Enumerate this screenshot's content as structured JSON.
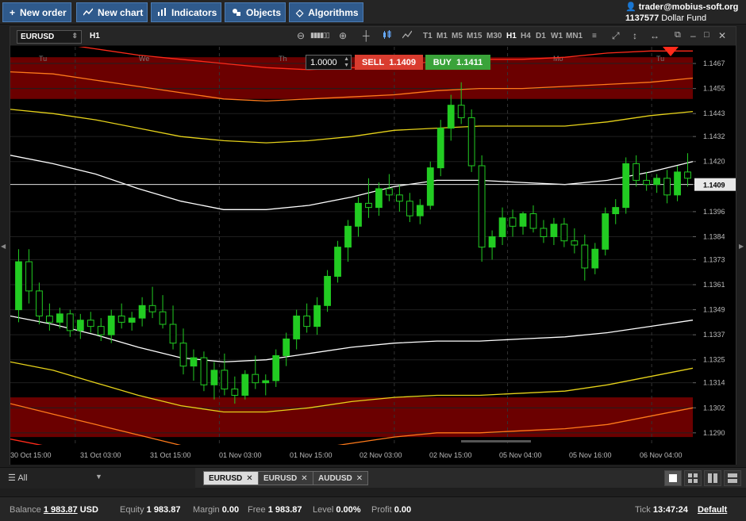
{
  "toolbar": {
    "new_order": "New order",
    "new_chart": "New chart",
    "indicators": "Indicators",
    "objects": "Objects",
    "algorithms": "Algorithms"
  },
  "account": {
    "user": "trader@mobius-soft.org",
    "id": "1137577",
    "fund": "Dollar Fund"
  },
  "chart": {
    "symbol": "EURUSD",
    "timeframe": "H1",
    "timeframes": [
      "T1",
      "M1",
      "M5",
      "M15",
      "M30",
      "H1",
      "H4",
      "D1",
      "W1",
      "MN1"
    ],
    "active_timeframe": "H1",
    "quantity": "1.0000",
    "sell_label": "SELL",
    "sell_price": "1.1409",
    "buy_label": "BUY",
    "buy_price": "1.1411",
    "day_labels": [
      "Tu",
      "We",
      "Th",
      "Mo",
      "Tu"
    ],
    "price_ticks": [
      "1.1467",
      "1.1455",
      "1.1443",
      "1.1432",
      "1.1420",
      "1.1409",
      "1.1396",
      "1.1384",
      "1.1373",
      "1.1361",
      "1.1349",
      "1.1337",
      "1.1325",
      "1.1314",
      "1.1302",
      "1.1290"
    ],
    "current_price": "1.1409",
    "time_ticks": [
      "30 Oct 15:00",
      "31 Oct 03:00",
      "31 Oct 15:00",
      "01 Nov 03:00",
      "01 Nov 15:00",
      "02 Nov 03:00",
      "02 Nov 15:00",
      "05 Nov 04:00",
      "05 Nov 16:00",
      "06 Nov 04:00"
    ],
    "colors": {
      "bull": "#22cc22",
      "band_fill": "#6b0000",
      "outer": "#ff2a1a",
      "mid_outer": "#ff7a1a",
      "inner": "#e6d21a",
      "center": "#ffffff"
    }
  },
  "chart_data": {
    "type": "candlestick",
    "symbol": "EURUSD",
    "timeframe": "H1",
    "ylim": [
      1.1285,
      1.1475
    ],
    "candles": [
      [
        1.1349,
        1.1378,
        1.1343,
        1.1372
      ],
      [
        1.1372,
        1.1378,
        1.1352,
        1.1358
      ],
      [
        1.1358,
        1.1362,
        1.1342,
        1.1346
      ],
      [
        1.1346,
        1.1352,
        1.1339,
        1.1343
      ],
      [
        1.1343,
        1.135,
        1.134,
        1.1347
      ],
      [
        1.1347,
        1.1349,
        1.1336,
        1.1339
      ],
      [
        1.1339,
        1.1347,
        1.1335,
        1.1344
      ],
      [
        1.1344,
        1.1348,
        1.1338,
        1.1341
      ],
      [
        1.1341,
        1.1345,
        1.1334,
        1.1337
      ],
      [
        1.1337,
        1.1349,
        1.1333,
        1.1346
      ],
      [
        1.1346,
        1.1352,
        1.134,
        1.1343
      ],
      [
        1.1343,
        1.1348,
        1.1339,
        1.1345
      ],
      [
        1.1345,
        1.1355,
        1.1341,
        1.1351
      ],
      [
        1.1351,
        1.136,
        1.1345,
        1.1348
      ],
      [
        1.1348,
        1.1356,
        1.134,
        1.1342
      ],
      [
        1.1342,
        1.1351,
        1.133,
        1.1333
      ],
      [
        1.1333,
        1.134,
        1.1318,
        1.1322
      ],
      [
        1.1322,
        1.133,
        1.1315,
        1.1326
      ],
      [
        1.1326,
        1.1329,
        1.131,
        1.1313
      ],
      [
        1.1313,
        1.1324,
        1.1306,
        1.132
      ],
      [
        1.132,
        1.1328,
        1.1308,
        1.1311
      ],
      [
        1.1311,
        1.1317,
        1.1304,
        1.1308
      ],
      [
        1.1308,
        1.132,
        1.1306,
        1.1318
      ],
      [
        1.1318,
        1.1327,
        1.1311,
        1.1314
      ],
      [
        1.1314,
        1.1318,
        1.1308,
        1.1315
      ],
      [
        1.1315,
        1.133,
        1.1312,
        1.1327
      ],
      [
        1.1327,
        1.1338,
        1.1322,
        1.1335
      ],
      [
        1.1335,
        1.1349,
        1.133,
        1.1346
      ],
      [
        1.1346,
        1.1352,
        1.1338,
        1.1341
      ],
      [
        1.1341,
        1.1355,
        1.1337,
        1.1351
      ],
      [
        1.1351,
        1.1368,
        1.1348,
        1.1365
      ],
      [
        1.1365,
        1.1382,
        1.1362,
        1.1379
      ],
      [
        1.1379,
        1.1392,
        1.1372,
        1.1389
      ],
      [
        1.1389,
        1.1403,
        1.1384,
        1.14
      ],
      [
        1.14,
        1.1412,
        1.1393,
        1.1398
      ],
      [
        1.1398,
        1.141,
        1.1394,
        1.1407
      ],
      [
        1.1407,
        1.1414,
        1.1401,
        1.1404
      ],
      [
        1.1404,
        1.1409,
        1.1396,
        1.1401
      ],
      [
        1.1401,
        1.1405,
        1.1391,
        1.1394
      ],
      [
        1.1394,
        1.1402,
        1.139,
        1.1399
      ],
      [
        1.1399,
        1.142,
        1.1397,
        1.1417
      ],
      [
        1.1417,
        1.144,
        1.1413,
        1.1436
      ],
      [
        1.1436,
        1.1452,
        1.143,
        1.1447
      ],
      [
        1.1447,
        1.1458,
        1.1438,
        1.1441
      ],
      [
        1.1441,
        1.1445,
        1.1415,
        1.1418
      ],
      [
        1.1418,
        1.1423,
        1.1372,
        1.1379
      ],
      [
        1.1379,
        1.1387,
        1.1373,
        1.1384
      ],
      [
        1.1384,
        1.1398,
        1.138,
        1.1393
      ],
      [
        1.1393,
        1.1397,
        1.1384,
        1.1389
      ],
      [
        1.1389,
        1.1396,
        1.1385,
        1.1395
      ],
      [
        1.1395,
        1.1399,
        1.1386,
        1.1388
      ],
      [
        1.1388,
        1.1392,
        1.1381,
        1.1384
      ],
      [
        1.1384,
        1.1393,
        1.138,
        1.139
      ],
      [
        1.139,
        1.1393,
        1.1379,
        1.1382
      ],
      [
        1.1382,
        1.1388,
        1.1376,
        1.138
      ],
      [
        1.138,
        1.1385,
        1.1363,
        1.1369
      ],
      [
        1.1369,
        1.1381,
        1.1366,
        1.1378
      ],
      [
        1.1378,
        1.1398,
        1.1375,
        1.1395
      ],
      [
        1.1395,
        1.1402,
        1.139,
        1.1398
      ],
      [
        1.1398,
        1.1422,
        1.1395,
        1.1419
      ],
      [
        1.1419,
        1.1423,
        1.1408,
        1.1411
      ],
      [
        1.1411,
        1.1415,
        1.1406,
        1.1409
      ],
      [
        1.1409,
        1.1414,
        1.1405,
        1.1412
      ],
      [
        1.1412,
        1.1416,
        1.14,
        1.1404
      ],
      [
        1.1404,
        1.1418,
        1.1401,
        1.1415
      ],
      [
        1.1415,
        1.1424,
        1.1408,
        1.1412
      ]
    ],
    "series": [
      {
        "name": "",
        "color": "#ff2a1a",
        "values": [
          1.1478,
          1.1477,
          1.1474,
          1.1471,
          1.1469,
          1.1467,
          1.1465,
          1.1464,
          1.1465,
          1.1466,
          1.1468,
          1.1469,
          1.1469,
          1.147,
          1.1472,
          1.1473,
          1.1473
        ]
      },
      {
        "name": "",
        "color": "#ff7a1a",
        "values": [
          1.1463,
          1.1462,
          1.1459,
          1.1456,
          1.1453,
          1.145,
          1.1449,
          1.145,
          1.1451,
          1.1452,
          1.1454,
          1.1455,
          1.1455,
          1.1456,
          1.1457,
          1.1458,
          1.146
        ]
      },
      {
        "name": "",
        "color": "#e6d21a",
        "values": [
          1.1445,
          1.1443,
          1.144,
          1.1436,
          1.1432,
          1.143,
          1.1429,
          1.143,
          1.1432,
          1.1435,
          1.1436,
          1.1437,
          1.1437,
          1.1437,
          1.1439,
          1.1442,
          1.1444
        ]
      },
      {
        "name": "",
        "color": "#ffffff",
        "values": [
          1.1423,
          1.1419,
          1.1414,
          1.1407,
          1.1401,
          1.1397,
          1.1397,
          1.1399,
          1.1403,
          1.1408,
          1.1411,
          1.1411,
          1.141,
          1.1409,
          1.1411,
          1.1415,
          1.142
        ]
      },
      {
        "name": "",
        "color": "#ffffff",
        "values": [
          1.1346,
          1.1342,
          1.1337,
          1.1331,
          1.1326,
          1.1324,
          1.1325,
          1.1328,
          1.1331,
          1.1333,
          1.1334,
          1.1334,
          1.1335,
          1.1336,
          1.1338,
          1.1341,
          1.1344
        ]
      },
      {
        "name": "",
        "color": "#e6d21a",
        "values": [
          1.1324,
          1.132,
          1.1314,
          1.1308,
          1.1303,
          1.13,
          1.13,
          1.1302,
          1.1305,
          1.1307,
          1.1308,
          1.1308,
          1.1309,
          1.131,
          1.1313,
          1.1317,
          1.1321
        ]
      },
      {
        "name": "",
        "color": "#ff7a1a",
        "values": [
          1.1304,
          1.1299,
          1.1294,
          1.1289,
          1.1284,
          1.1281,
          1.128,
          1.1282,
          1.1285,
          1.1288,
          1.129,
          1.129,
          1.1291,
          1.1292,
          1.1294,
          1.1298,
          1.1302
        ]
      },
      {
        "name": "",
        "color": "#ff2a1a",
        "values": [
          1.1287,
          1.1283,
          1.1278,
          1.1274,
          1.127,
          1.1267,
          1.1266,
          1.1268,
          1.127,
          1.1272,
          1.1274,
          1.1274,
          1.1275,
          1.1276,
          1.1277,
          1.128,
          1.1284
        ]
      }
    ],
    "bands": [
      [
        1.145,
        1.147
      ],
      [
        1.1288,
        1.1307
      ]
    ],
    "horizontal_line": 1.1409
  },
  "bottom": {
    "filter": "All",
    "tabs": [
      {
        "label": "EURUSD",
        "active": true
      },
      {
        "label": "EURUSD",
        "active": false
      },
      {
        "label": "AUDUSD",
        "active": false
      }
    ]
  },
  "status": {
    "balance_label": "Balance",
    "balance": "1 983.87",
    "currency": "USD",
    "equity_label": "Equity",
    "equity": "1 983.87",
    "margin_label": "Margin",
    "margin": "0.00",
    "free_label": "Free",
    "free": "1 983.87",
    "level_label": "Level",
    "level": "0.00%",
    "profit_label": "Profit",
    "profit": "0.00",
    "tick_label": "Tick",
    "tick": "13:47:24",
    "profile": "Default"
  }
}
